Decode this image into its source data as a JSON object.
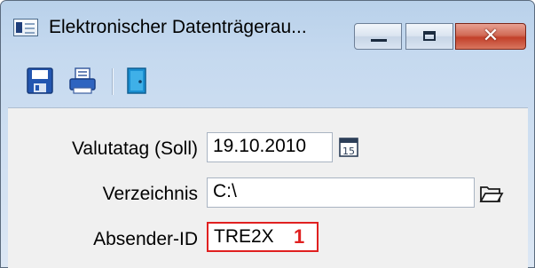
{
  "window": {
    "title": "Elektronischer Datenträgerau...",
    "controls": {
      "minimize": "minimize",
      "maximize": "maximize",
      "close": "✕"
    }
  },
  "toolbar": {
    "items": [
      {
        "icon": "save-icon",
        "tooltip": ""
      },
      {
        "icon": "print-icon",
        "tooltip": ""
      },
      {
        "icon": "exit-door-icon",
        "tooltip": ""
      }
    ]
  },
  "form": {
    "valuta_label": "Valutatag (Soll)",
    "valuta_value": "19.10.2010",
    "directory_label": "Verzeichnis",
    "directory_value": "C:\\",
    "sender_label": "Absender-ID",
    "sender_value": "TRE2X",
    "sender_marker": "1"
  },
  "colors": {
    "highlight": "#e02020",
    "titlebar": "#b9d1ea",
    "client": "#f0f0f0"
  }
}
